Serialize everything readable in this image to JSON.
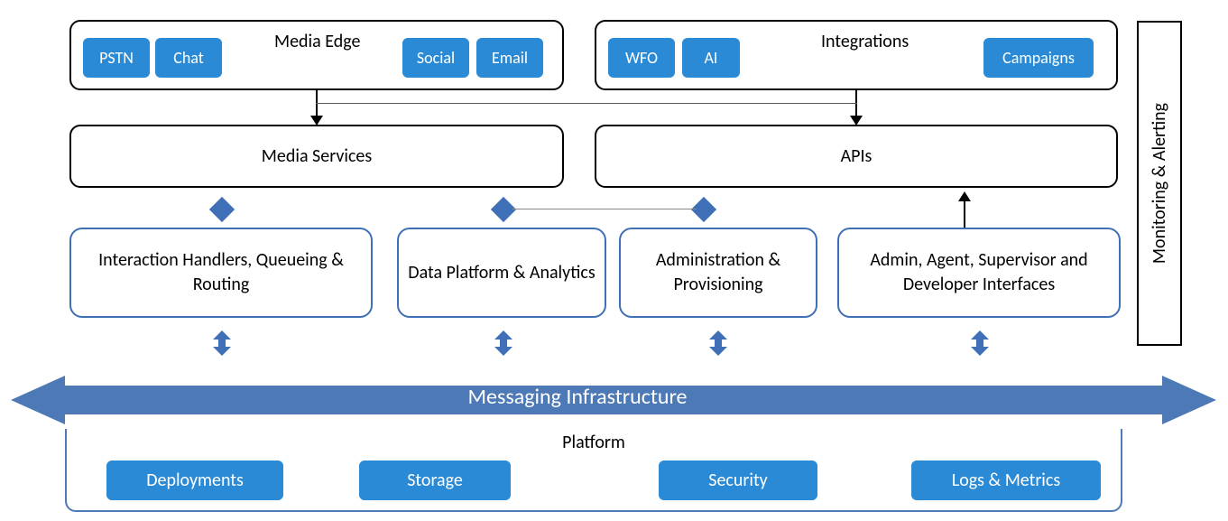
{
  "row1": {
    "media_edge": {
      "title": "Media Edge",
      "chips": {
        "pstn": "PSTN",
        "chat": "Chat",
        "social": "Social",
        "email": "Email"
      }
    },
    "integrations": {
      "title": "Integrations",
      "chips": {
        "wfo": "WFO",
        "ai": "AI",
        "campaigns": "Campaigns"
      }
    }
  },
  "row2": {
    "media_services": "Media  Services",
    "apis": "APIs"
  },
  "row3": {
    "interaction": "Interaction Handlers, Queueing & Routing",
    "data_platform": "Data Platform & Analytics",
    "admin_prov": "Administration & Provisioning",
    "interfaces": "Admin, Agent, Supervisor and Developer Interfaces"
  },
  "messaging": "Messaging Infrastructure",
  "platform": {
    "title": "Platform",
    "deployments": "Deployments",
    "storage": "Storage",
    "security": "Security",
    "logs": "Logs & Metrics"
  },
  "sidebar": "Monitoring & Alerting"
}
